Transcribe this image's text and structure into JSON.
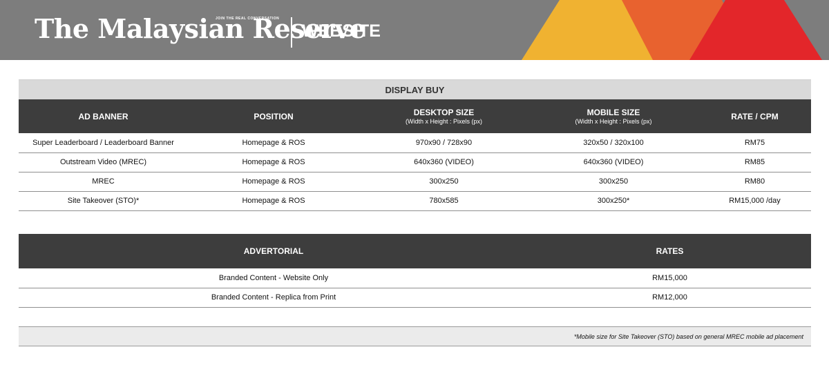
{
  "header": {
    "logo_text": "The Malaysian Reserve",
    "logo_tagline": "JOIN THE REAL CONVERSATION",
    "section_title": "WEBSITE",
    "background_color": "#7d7d7d",
    "accent_colors": [
      "#f0b231",
      "#e8622f",
      "#e3262a"
    ]
  },
  "display_buy": {
    "caption": "DISPLAY BUY",
    "columns": [
      {
        "label": "AD BANNER",
        "sub": ""
      },
      {
        "label": "POSITION",
        "sub": ""
      },
      {
        "label": "DESKTOP SIZE",
        "sub": "(Width x Height : Pixels (px)"
      },
      {
        "label": "MOBILE SIZE",
        "sub": "(Width x Height : Pixels (px)"
      },
      {
        "label": "RATE / CPM",
        "sub": ""
      }
    ],
    "rows": [
      [
        "Super Leaderboard / Leaderboard Banner",
        "Homepage & ROS",
        "970x90 / 728x90",
        "320x50 / 320x100",
        "RM75"
      ],
      [
        "Outstream Video (MREC)",
        "Homepage & ROS",
        "640x360 (VIDEO)",
        "640x360 (VIDEO)",
        "RM85"
      ],
      [
        "MREC",
        "Homepage & ROS",
        "300x250",
        "300x250",
        "RM80"
      ],
      [
        "Site Takeover (STO)*",
        "Homepage & ROS",
        "780x585",
        "300x250*",
        "RM15,000 /day"
      ]
    ]
  },
  "advertorial": {
    "columns": [
      "ADVERTORIAL",
      "RATES"
    ],
    "rows": [
      [
        "Branded Content - Website Only",
        "RM15,000"
      ],
      [
        "Branded Content - Replica from Print",
        "RM12,000"
      ]
    ]
  },
  "footnote": "*Mobile size for Site Takeover (STO) based on general MREC mobile ad placement"
}
